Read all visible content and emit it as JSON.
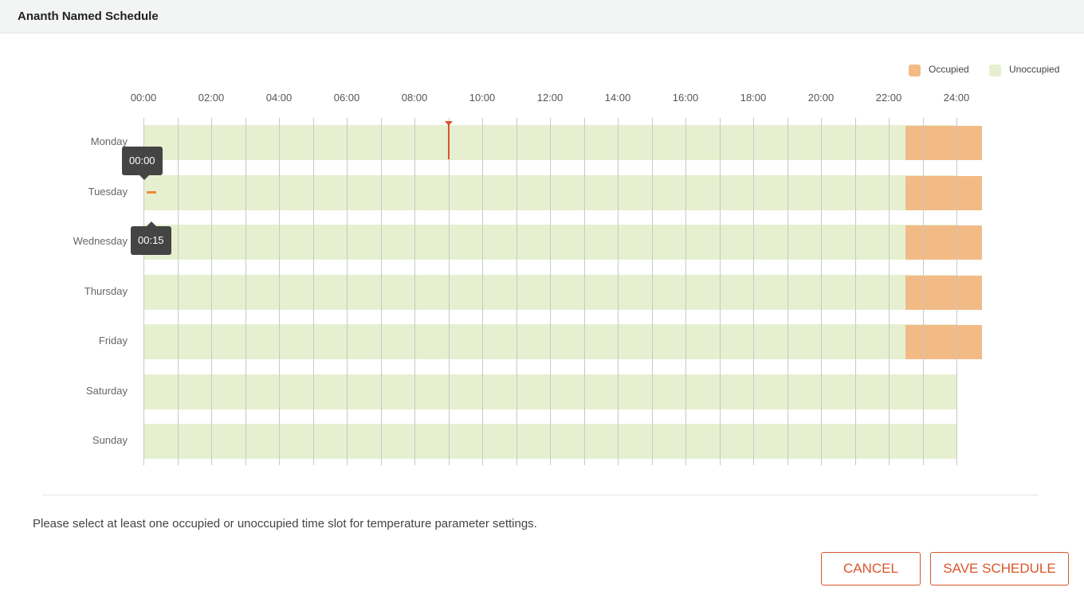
{
  "header": {
    "title": "Ananth Named Schedule"
  },
  "legend": [
    {
      "label": "Occupied",
      "color": "#f2bb86"
    },
    {
      "label": "Unoccupied",
      "color": "#e6f0d0"
    }
  ],
  "timeline": {
    "hours": [
      "00:00",
      "02:00",
      "04:00",
      "06:00",
      "08:00",
      "10:00",
      "12:00",
      "14:00",
      "16:00",
      "18:00",
      "20:00",
      "22:00",
      "24:00"
    ],
    "days": [
      "Monday",
      "Tuesday",
      "Wednesday",
      "Thursday",
      "Friday",
      "Saturday",
      "Sunday"
    ],
    "occupied": [
      {
        "day": "Monday",
        "start": "22:30",
        "end": "24:45"
      },
      {
        "day": "Tuesday",
        "start": "22:30",
        "end": "24:45"
      },
      {
        "day": "Wednesday",
        "start": "22:30",
        "end": "24:45"
      },
      {
        "day": "Thursday",
        "start": "22:30",
        "end": "24:45"
      },
      {
        "day": "Friday",
        "start": "22:30",
        "end": "24:45"
      }
    ],
    "current_time": "09:00",
    "selection": {
      "day": "Tuesday",
      "start": "00:00",
      "end": "00:15"
    },
    "tooltip_start": "00:00",
    "tooltip_end": "00:15",
    "colors": {
      "occupied": "#f2bb86",
      "unoccupied": "#e6f0d0",
      "marker": "#d9552a",
      "selection": "#f08a3c"
    }
  },
  "note": "Please select at least one occupied or unoccupied time slot for temperature parameter settings.",
  "buttons": {
    "cancel": "CANCEL",
    "save": "SAVE SCHEDULE"
  }
}
